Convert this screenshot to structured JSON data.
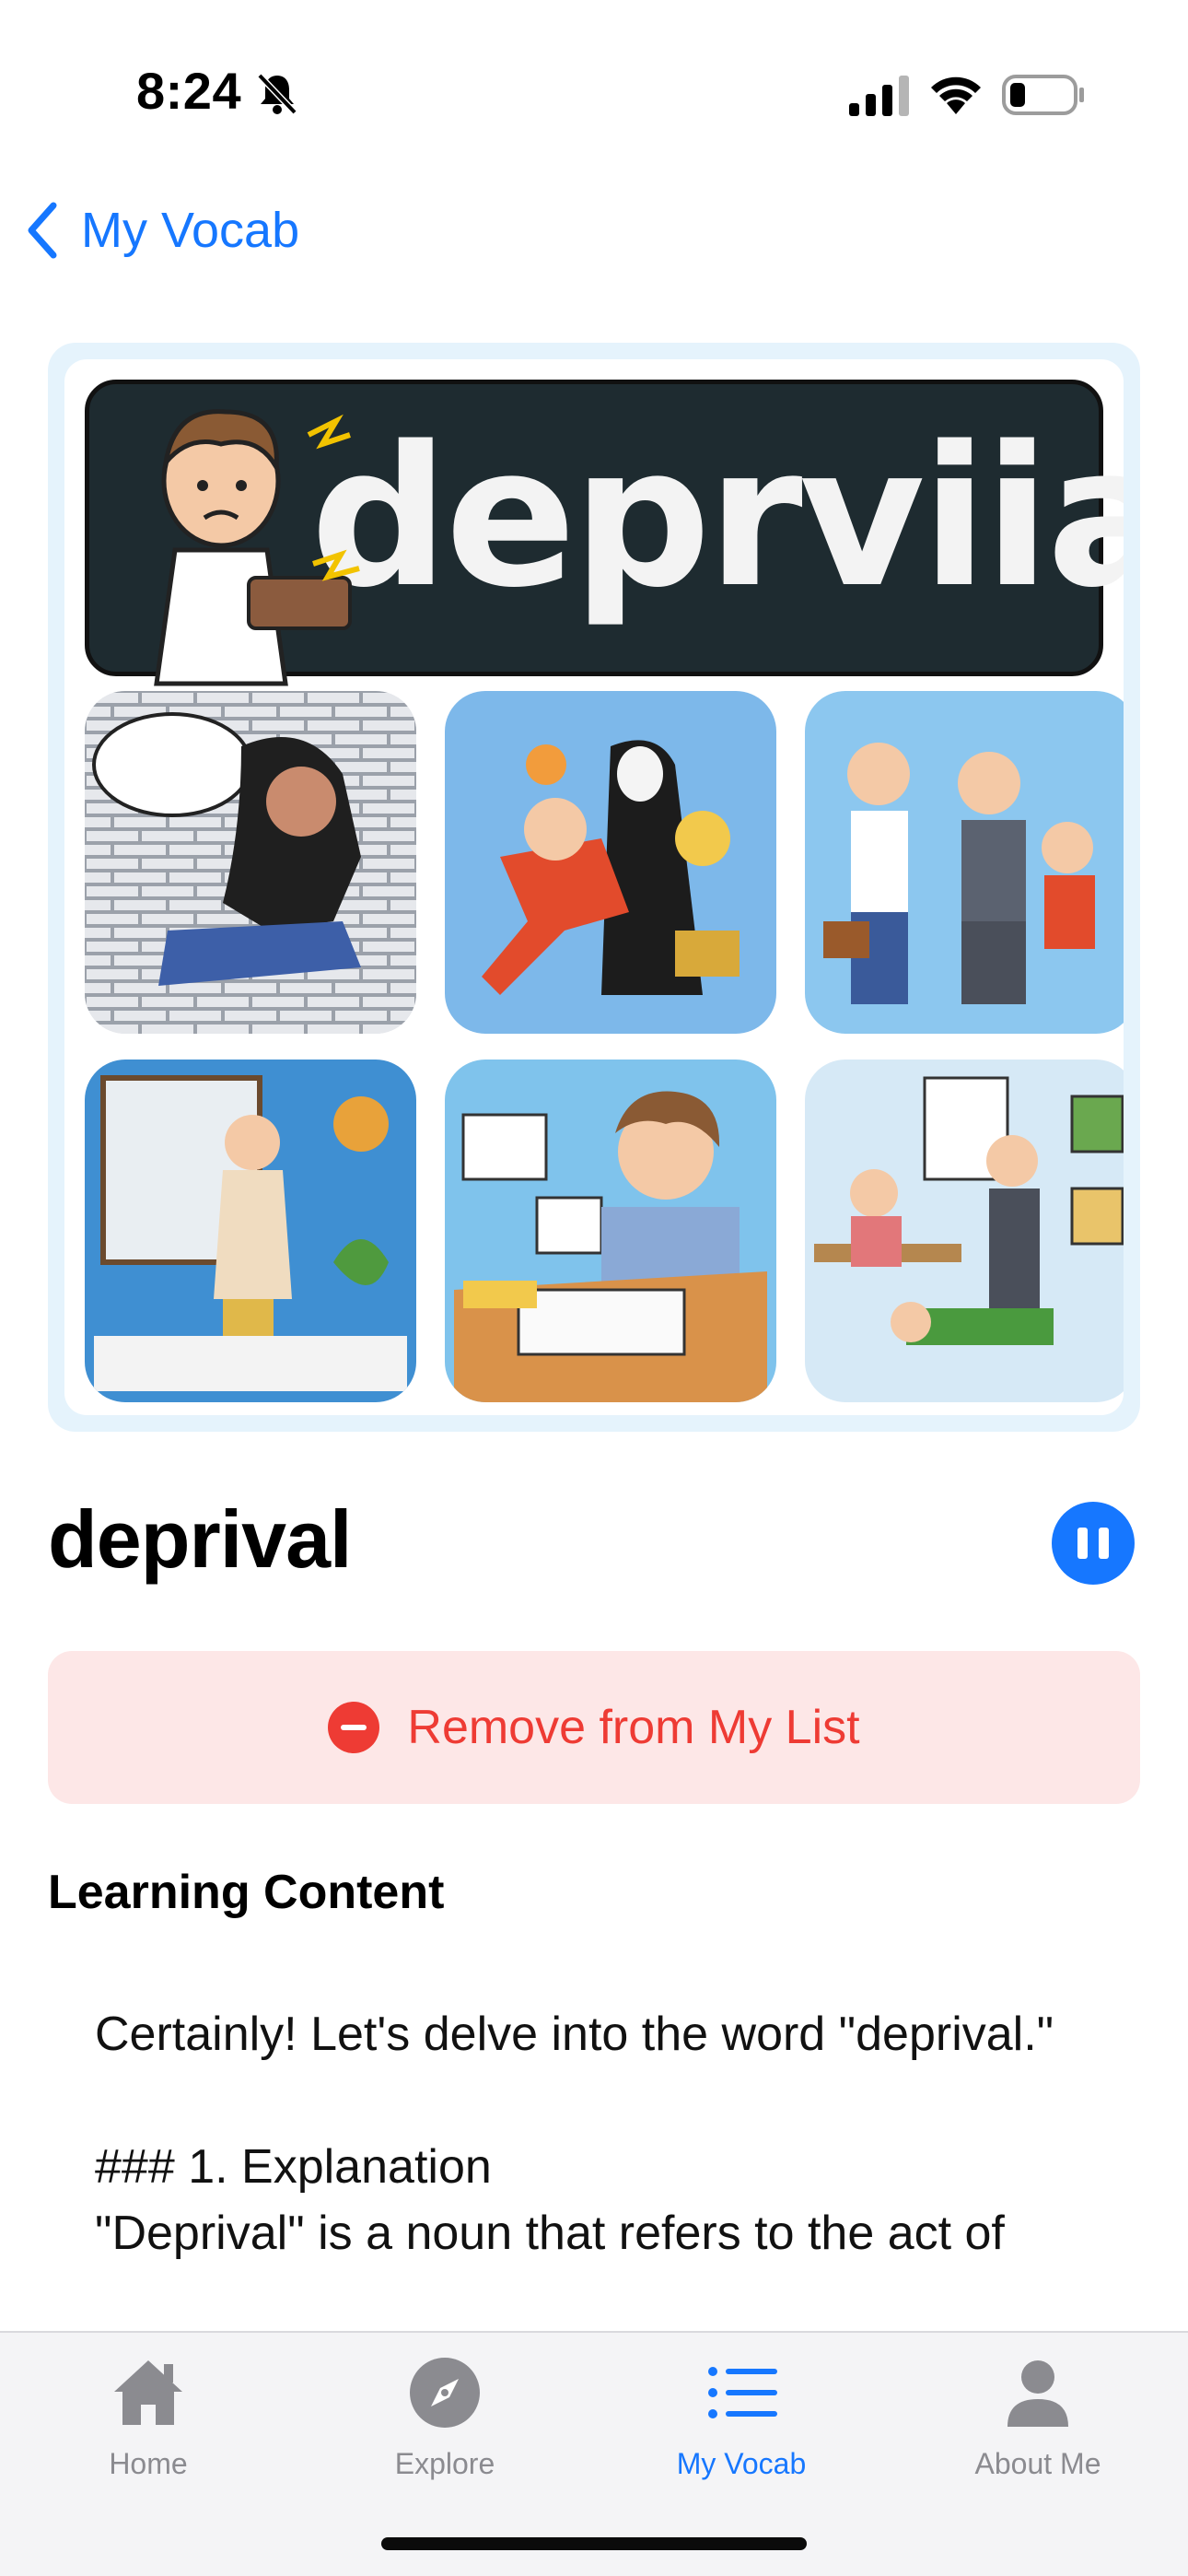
{
  "status_bar": {
    "time": "8:24",
    "icons": [
      "bell-slash-icon",
      "cellular-signal-icon",
      "wifi-icon",
      "battery-icon"
    ]
  },
  "nav": {
    "back_label": "My Vocab"
  },
  "hero_image": {
    "banner_text": "deprviial’"
  },
  "word": {
    "title": "deprival",
    "play_state": "playing"
  },
  "actions": {
    "remove_label": "Remove from My List"
  },
  "learning": {
    "heading": "Learning Content",
    "text": "Certainly! Let's delve into the word \"deprival.\"\n\n### 1. Explanation\n\"Deprival\" is a noun that refers to the act of"
  },
  "tab_bar": {
    "tabs": [
      {
        "label": "Home",
        "icon": "house-icon",
        "active": false
      },
      {
        "label": "Explore",
        "icon": "compass-icon",
        "active": false
      },
      {
        "label": "My Vocab",
        "icon": "list-icon",
        "active": true
      },
      {
        "label": "About Me",
        "icon": "person-icon",
        "active": false
      }
    ]
  },
  "colors": {
    "accent": "#1677ff",
    "destructive": "#ee3b34",
    "destructive_bg": "#fde7e7",
    "tab_inactive": "#8b8b90"
  }
}
